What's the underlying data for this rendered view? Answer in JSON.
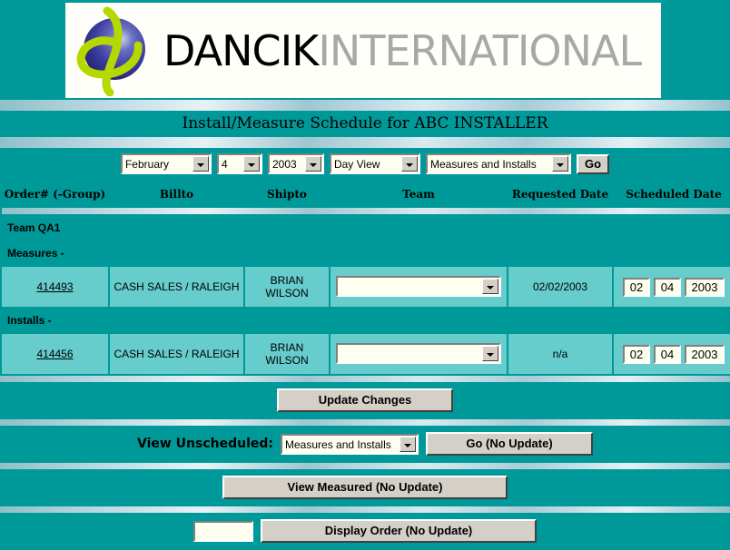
{
  "theme": {
    "teal_dark": "#009999",
    "teal_light": "#66cccc",
    "button_face": "#d4d0c8",
    "field_bg": "#fffff0",
    "logo_sphere": "#3b3b9e",
    "logo_swoosh": "#b5d800"
  },
  "banner": {
    "logo_icon": "dancik-globe-logo",
    "brand_primary": "DANCIK",
    "brand_secondary": "INTERNATIONAL"
  },
  "page_title": "Install/Measure Schedule for ABC INSTALLER",
  "toolbar": {
    "month": "February",
    "day": "4",
    "year": "2003",
    "view_mode": "Day View",
    "record_type": "Measures and Installs",
    "go_label": "Go"
  },
  "table": {
    "headers": [
      "Order# (-Group)",
      "Billto",
      "Shipto",
      "Team",
      "Requested Date",
      "Scheduled Date"
    ],
    "group_team": "Team QA1",
    "section_measures": "Measures -",
    "section_installs": "Installs -",
    "rows": [
      {
        "order": "414493",
        "billto": "CASH SALES / RALEIGH",
        "shipto": "BRIAN WILSON",
        "team": "",
        "requested_date": "02/02/2003",
        "sched_month": "02",
        "sched_day": "04",
        "sched_year": "2003"
      },
      {
        "order": "414456",
        "billto": "CASH SALES / RALEIGH",
        "shipto": "BRIAN WILSON",
        "team": "",
        "requested_date": "n/a",
        "sched_month": "02",
        "sched_day": "04",
        "sched_year": "2003"
      }
    ]
  },
  "actions": {
    "update_changes": "Update Changes",
    "view_unscheduled_label": "View Unscheduled:",
    "view_unscheduled_value": "Measures and Installs",
    "go_no_update": "Go (No Update)",
    "view_measured": "View Measured (No Update)",
    "display_order_value": "",
    "display_order": "Display Order (No Update)"
  }
}
